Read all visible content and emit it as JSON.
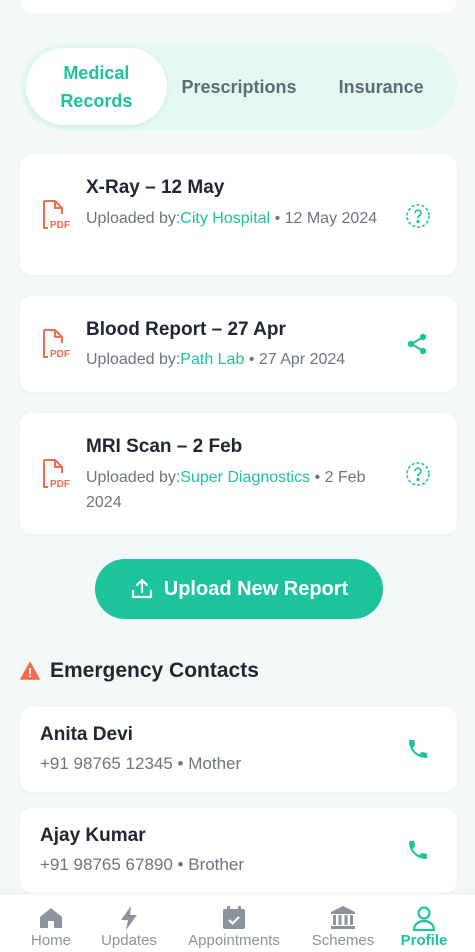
{
  "tabs": [
    {
      "label": "Medical Records",
      "active": true
    },
    {
      "label": "Prescriptions",
      "active": false
    },
    {
      "label": "Insurance",
      "active": false
    }
  ],
  "records": [
    {
      "title": "X-Ray – 12 May",
      "uploaded_by_label": "Uploaded by:",
      "source": "City Hospital",
      "date": "• 12 May 2024",
      "action_icon": "help-icon"
    },
    {
      "title": "Blood Report – 27 Apr",
      "uploaded_by_label": "Uploaded by:",
      "source": "Path Lab",
      "date": "• 27 Apr 2024",
      "action_icon": "share-icon"
    },
    {
      "title": "MRI Scan – 2 Feb",
      "uploaded_by_label": "Uploaded by:",
      "source": "Super Diagnostics",
      "date": "• 2 Feb 2024",
      "action_icon": "help-icon"
    }
  ],
  "upload_button": {
    "label": "Upload New Report"
  },
  "emergency": {
    "heading": "Emergency Contacts",
    "contacts": [
      {
        "name": "Anita Devi",
        "detail": "+91 98765 12345 • Mother"
      },
      {
        "name": "Ajay Kumar",
        "detail": "+91 98765 67890 • Brother"
      }
    ]
  },
  "nav": [
    {
      "label": "Home",
      "icon": "home-icon",
      "active": false
    },
    {
      "label": "Updates",
      "icon": "lightning-icon",
      "active": false
    },
    {
      "label": "Appointments",
      "icon": "calendar-icon",
      "active": false
    },
    {
      "label": "Schemes",
      "icon": "bank-icon",
      "active": false
    },
    {
      "label": "Profile",
      "icon": "user-icon",
      "active": true
    }
  ],
  "colors": {
    "accent": "#1cc39c",
    "pdf": "#f26b4f",
    "warning": "#f26b4f",
    "tab_bg": "#e3f8f3"
  }
}
